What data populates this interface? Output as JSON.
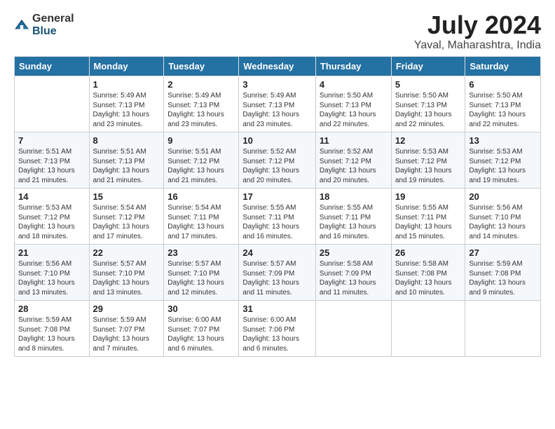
{
  "logo": {
    "general": "General",
    "blue": "Blue"
  },
  "header": {
    "month_year": "July 2024",
    "location": "Yaval, Maharashtra, India"
  },
  "weekdays": [
    "Sunday",
    "Monday",
    "Tuesday",
    "Wednesday",
    "Thursday",
    "Friday",
    "Saturday"
  ],
  "weeks": [
    [
      {
        "day": "",
        "sunrise": "",
        "sunset": "",
        "daylight": ""
      },
      {
        "day": "1",
        "sunrise": "Sunrise: 5:49 AM",
        "sunset": "Sunset: 7:13 PM",
        "daylight": "Daylight: 13 hours and 23 minutes."
      },
      {
        "day": "2",
        "sunrise": "Sunrise: 5:49 AM",
        "sunset": "Sunset: 7:13 PM",
        "daylight": "Daylight: 13 hours and 23 minutes."
      },
      {
        "day": "3",
        "sunrise": "Sunrise: 5:49 AM",
        "sunset": "Sunset: 7:13 PM",
        "daylight": "Daylight: 13 hours and 23 minutes."
      },
      {
        "day": "4",
        "sunrise": "Sunrise: 5:50 AM",
        "sunset": "Sunset: 7:13 PM",
        "daylight": "Daylight: 13 hours and 22 minutes."
      },
      {
        "day": "5",
        "sunrise": "Sunrise: 5:50 AM",
        "sunset": "Sunset: 7:13 PM",
        "daylight": "Daylight: 13 hours and 22 minutes."
      },
      {
        "day": "6",
        "sunrise": "Sunrise: 5:50 AM",
        "sunset": "Sunset: 7:13 PM",
        "daylight": "Daylight: 13 hours and 22 minutes."
      }
    ],
    [
      {
        "day": "7",
        "sunrise": "Sunrise: 5:51 AM",
        "sunset": "Sunset: 7:13 PM",
        "daylight": "Daylight: 13 hours and 21 minutes."
      },
      {
        "day": "8",
        "sunrise": "Sunrise: 5:51 AM",
        "sunset": "Sunset: 7:13 PM",
        "daylight": "Daylight: 13 hours and 21 minutes."
      },
      {
        "day": "9",
        "sunrise": "Sunrise: 5:51 AM",
        "sunset": "Sunset: 7:12 PM",
        "daylight": "Daylight: 13 hours and 21 minutes."
      },
      {
        "day": "10",
        "sunrise": "Sunrise: 5:52 AM",
        "sunset": "Sunset: 7:12 PM",
        "daylight": "Daylight: 13 hours and 20 minutes."
      },
      {
        "day": "11",
        "sunrise": "Sunrise: 5:52 AM",
        "sunset": "Sunset: 7:12 PM",
        "daylight": "Daylight: 13 hours and 20 minutes."
      },
      {
        "day": "12",
        "sunrise": "Sunrise: 5:53 AM",
        "sunset": "Sunset: 7:12 PM",
        "daylight": "Daylight: 13 hours and 19 minutes."
      },
      {
        "day": "13",
        "sunrise": "Sunrise: 5:53 AM",
        "sunset": "Sunset: 7:12 PM",
        "daylight": "Daylight: 13 hours and 19 minutes."
      }
    ],
    [
      {
        "day": "14",
        "sunrise": "Sunrise: 5:53 AM",
        "sunset": "Sunset: 7:12 PM",
        "daylight": "Daylight: 13 hours and 18 minutes."
      },
      {
        "day": "15",
        "sunrise": "Sunrise: 5:54 AM",
        "sunset": "Sunset: 7:12 PM",
        "daylight": "Daylight: 13 hours and 17 minutes."
      },
      {
        "day": "16",
        "sunrise": "Sunrise: 5:54 AM",
        "sunset": "Sunset: 7:11 PM",
        "daylight": "Daylight: 13 hours and 17 minutes."
      },
      {
        "day": "17",
        "sunrise": "Sunrise: 5:55 AM",
        "sunset": "Sunset: 7:11 PM",
        "daylight": "Daylight: 13 hours and 16 minutes."
      },
      {
        "day": "18",
        "sunrise": "Sunrise: 5:55 AM",
        "sunset": "Sunset: 7:11 PM",
        "daylight": "Daylight: 13 hours and 16 minutes."
      },
      {
        "day": "19",
        "sunrise": "Sunrise: 5:55 AM",
        "sunset": "Sunset: 7:11 PM",
        "daylight": "Daylight: 13 hours and 15 minutes."
      },
      {
        "day": "20",
        "sunrise": "Sunrise: 5:56 AM",
        "sunset": "Sunset: 7:10 PM",
        "daylight": "Daylight: 13 hours and 14 minutes."
      }
    ],
    [
      {
        "day": "21",
        "sunrise": "Sunrise: 5:56 AM",
        "sunset": "Sunset: 7:10 PM",
        "daylight": "Daylight: 13 hours and 13 minutes."
      },
      {
        "day": "22",
        "sunrise": "Sunrise: 5:57 AM",
        "sunset": "Sunset: 7:10 PM",
        "daylight": "Daylight: 13 hours and 13 minutes."
      },
      {
        "day": "23",
        "sunrise": "Sunrise: 5:57 AM",
        "sunset": "Sunset: 7:10 PM",
        "daylight": "Daylight: 13 hours and 12 minutes."
      },
      {
        "day": "24",
        "sunrise": "Sunrise: 5:57 AM",
        "sunset": "Sunset: 7:09 PM",
        "daylight": "Daylight: 13 hours and 11 minutes."
      },
      {
        "day": "25",
        "sunrise": "Sunrise: 5:58 AM",
        "sunset": "Sunset: 7:09 PM",
        "daylight": "Daylight: 13 hours and 11 minutes."
      },
      {
        "day": "26",
        "sunrise": "Sunrise: 5:58 AM",
        "sunset": "Sunset: 7:08 PM",
        "daylight": "Daylight: 13 hours and 10 minutes."
      },
      {
        "day": "27",
        "sunrise": "Sunrise: 5:59 AM",
        "sunset": "Sunset: 7:08 PM",
        "daylight": "Daylight: 13 hours and 9 minutes."
      }
    ],
    [
      {
        "day": "28",
        "sunrise": "Sunrise: 5:59 AM",
        "sunset": "Sunset: 7:08 PM",
        "daylight": "Daylight: 13 hours and 8 minutes."
      },
      {
        "day": "29",
        "sunrise": "Sunrise: 5:59 AM",
        "sunset": "Sunset: 7:07 PM",
        "daylight": "Daylight: 13 hours and 7 minutes."
      },
      {
        "day": "30",
        "sunrise": "Sunrise: 6:00 AM",
        "sunset": "Sunset: 7:07 PM",
        "daylight": "Daylight: 13 hours and 6 minutes."
      },
      {
        "day": "31",
        "sunrise": "Sunrise: 6:00 AM",
        "sunset": "Sunset: 7:06 PM",
        "daylight": "Daylight: 13 hours and 6 minutes."
      },
      {
        "day": "",
        "sunrise": "",
        "sunset": "",
        "daylight": ""
      },
      {
        "day": "",
        "sunrise": "",
        "sunset": "",
        "daylight": ""
      },
      {
        "day": "",
        "sunrise": "",
        "sunset": "",
        "daylight": ""
      }
    ]
  ]
}
